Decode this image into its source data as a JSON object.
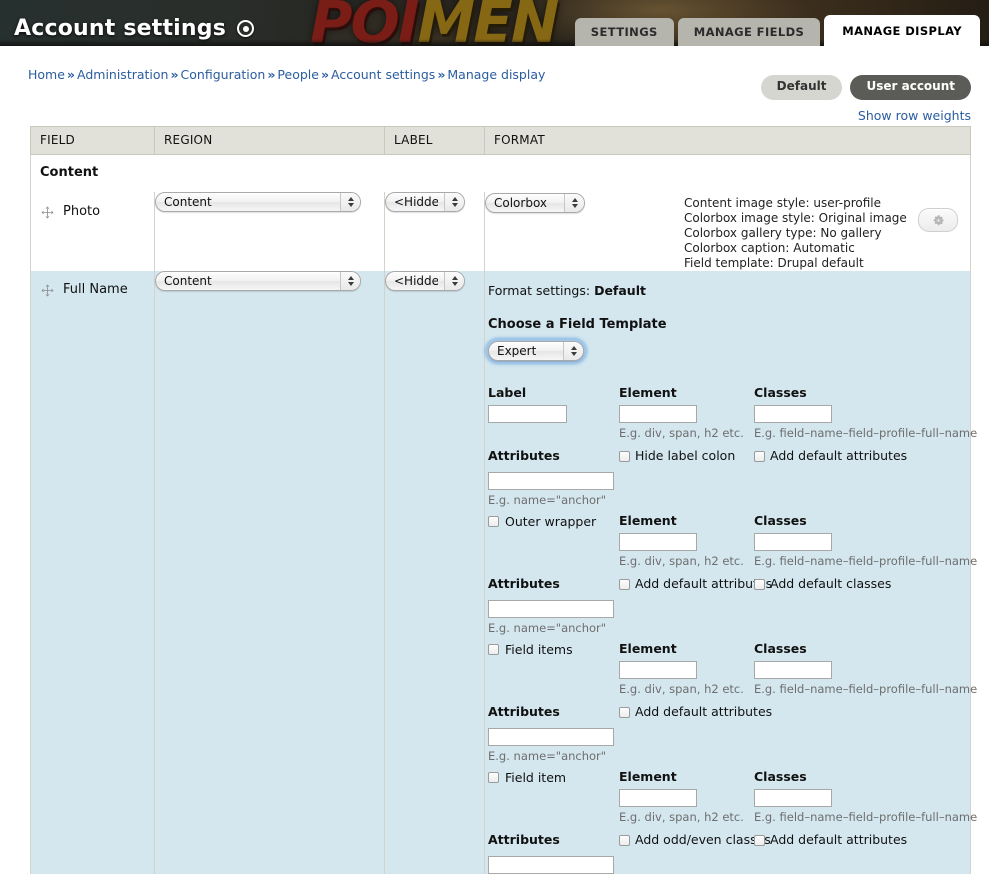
{
  "banner": {
    "title": "Account settings",
    "logo_part1": "POI",
    "logo_part2": "MEN",
    "gear_icon": "gear-circle-icon"
  },
  "primary_tabs": [
    {
      "label": "SETTINGS",
      "active": false
    },
    {
      "label": "MANAGE FIELDS",
      "active": false
    },
    {
      "label": "MANAGE DISPLAY",
      "active": true
    }
  ],
  "breadcrumb": {
    "separator": "»",
    "items": [
      "Home",
      "Administration",
      "Configuration",
      "People",
      "Account settings",
      "Manage display"
    ]
  },
  "view_modes": [
    {
      "label": "Default",
      "active": false
    },
    {
      "label": "User account",
      "active": true
    }
  ],
  "row_weights_link": "Show row weights",
  "table": {
    "headers": [
      "FIELD",
      "REGION",
      "LABEL",
      "FORMAT"
    ],
    "region_group": "Content",
    "rows": [
      {
        "field": "Photo",
        "region": "Content",
        "label": "<Hidden>",
        "format": "Colorbox",
        "summary": [
          "Content image style: user-profile",
          "Colorbox image style: Original image",
          "Colorbox gallery type: No gallery",
          "Colorbox caption: Automatic",
          "Field template: Drupal default"
        ],
        "gear_icon": "gear-icon"
      },
      {
        "field": "Full Name",
        "region": "Content",
        "label": "<Hidden>",
        "format_settings_prefix": "Format settings:",
        "format_settings_value": "Default",
        "template_heading": "Choose a Field Template",
        "template_value": "Expert"
      }
    ]
  },
  "expert": {
    "hint_element": "E.g. div, span, h2 etc.",
    "hint_classes": "E.g. field–name–field–profile–full–name",
    "hint_attributes": "E.g. name=\"anchor\"",
    "heading_element": "Element",
    "heading_classes": "Classes",
    "heading_attributes": "Attributes",
    "groups": [
      {
        "title": "Label",
        "title_is_checkbox": false,
        "element_value": "",
        "classes_value": "",
        "attributes_value": "",
        "checkbox_left": "Hide label colon",
        "checkbox_right": "Add default attributes"
      },
      {
        "title": "Outer wrapper",
        "title_is_checkbox": true,
        "element_value": "",
        "classes_value": "",
        "attributes_value": "",
        "checkbox_left": "Add default attributes",
        "checkbox_right": "Add default classes"
      },
      {
        "title": "Field items",
        "title_is_checkbox": true,
        "element_value": "",
        "classes_value": "",
        "attributes_value": "",
        "checkbox_left": "Add default attributes",
        "checkbox_right": ""
      },
      {
        "title": "Field item",
        "title_is_checkbox": true,
        "element_value": "",
        "classes_value": "",
        "attributes_value": "",
        "checkbox_left": "Add odd/even classes",
        "checkbox_right": "Add default attributes"
      }
    ]
  },
  "colors": {
    "highlight_row": "#d4e7ef",
    "table_header": "#e1e1d9",
    "link": "#2a5d9f",
    "active_pill": "#5b5b57"
  }
}
